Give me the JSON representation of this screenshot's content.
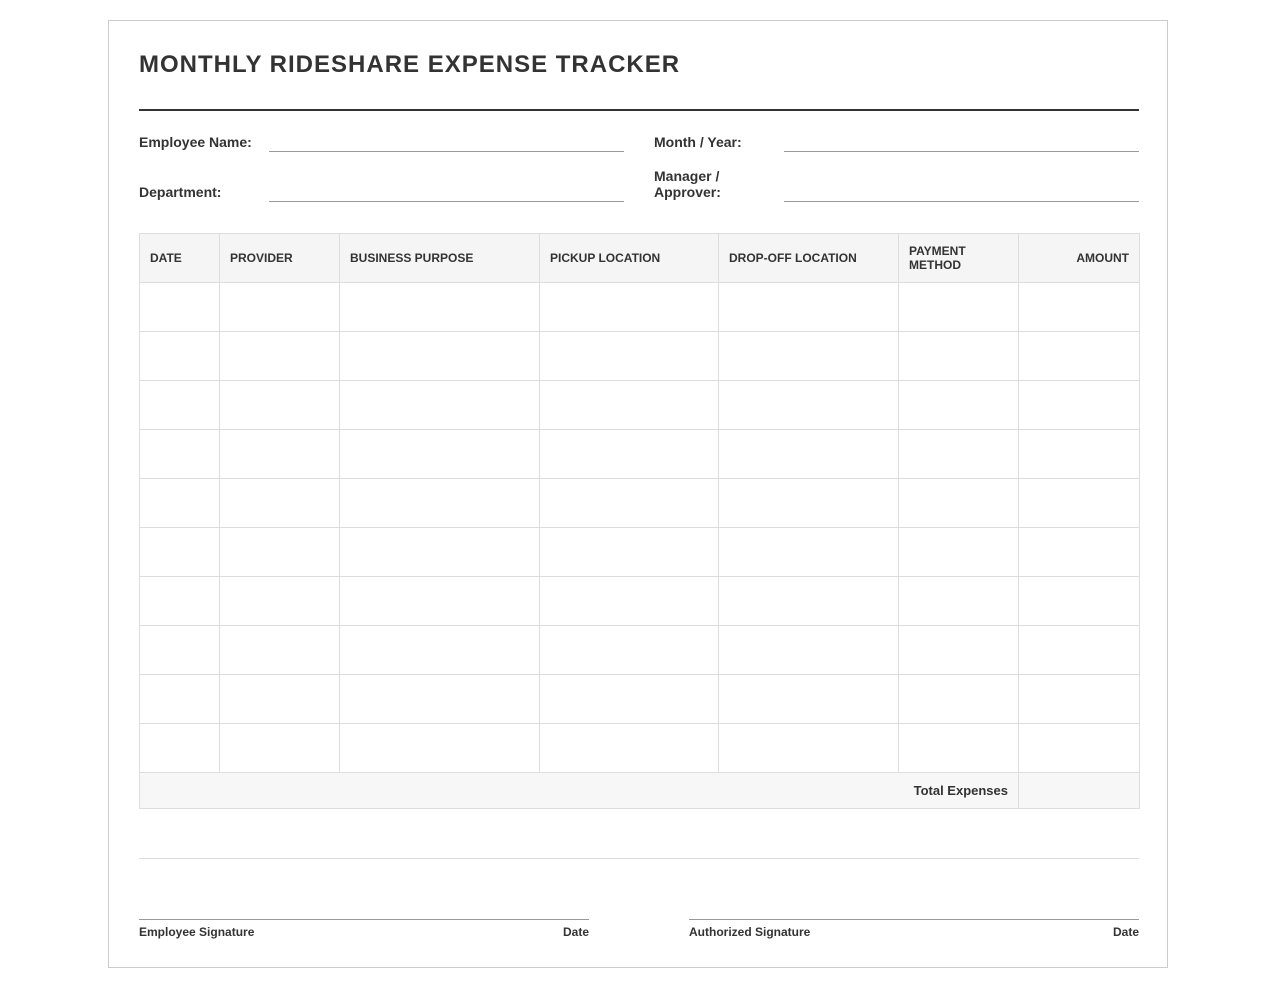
{
  "form": {
    "title": "MONTHLY RIDESHARE EXPENSE TRACKER",
    "fields": {
      "employee_name_label": "Employee Name:",
      "month_year_label": "Month / Year:",
      "department_label": "Department:",
      "manager_label_line1": "Manager /",
      "manager_label_line2": "Approver:",
      "employee_name_value": "",
      "month_year_value": "",
      "department_value": "",
      "manager_value": ""
    }
  },
  "table": {
    "columns": [
      "DATE",
      "PROVIDER",
      "BUSINESS PURPOSE",
      "PICKUP LOCATION",
      "DROP-OFF LOCATION",
      "PAYMENT METHOD",
      "AMOUNT"
    ],
    "payment_method_line1": "PAYMENT",
    "payment_method_line2": "METHOD",
    "rows": [
      [
        "",
        "",
        "",
        "",
        "",
        "",
        ""
      ],
      [
        "",
        "",
        "",
        "",
        "",
        "",
        ""
      ],
      [
        "",
        "",
        "",
        "",
        "",
        "",
        ""
      ],
      [
        "",
        "",
        "",
        "",
        "",
        "",
        ""
      ],
      [
        "",
        "",
        "",
        "",
        "",
        "",
        ""
      ],
      [
        "",
        "",
        "",
        "",
        "",
        "",
        ""
      ],
      [
        "",
        "",
        "",
        "",
        "",
        "",
        ""
      ],
      [
        "",
        "",
        "",
        "",
        "",
        "",
        ""
      ],
      [
        "",
        "",
        "",
        "",
        "",
        "",
        ""
      ],
      [
        "",
        "",
        "",
        "",
        "",
        "",
        ""
      ]
    ],
    "total_label": "Total Expenses",
    "total_value": ""
  },
  "signatures": {
    "employee_signature": "Employee Signature",
    "employee_date": "Date",
    "authorized_signature": "Authorized Signature",
    "authorized_date": "Date"
  }
}
